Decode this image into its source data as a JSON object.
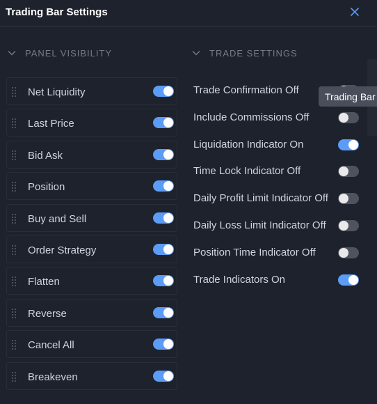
{
  "dialog": {
    "title": "Trading Bar Settings"
  },
  "panel_visibility": {
    "heading": "PANEL VISIBILITY",
    "items": [
      {
        "label": "Net Liquidity",
        "on": true
      },
      {
        "label": "Last Price",
        "on": true
      },
      {
        "label": "Bid Ask",
        "on": true
      },
      {
        "label": "Position",
        "on": true
      },
      {
        "label": "Buy and Sell",
        "on": true
      },
      {
        "label": "Order Strategy",
        "on": true
      },
      {
        "label": "Flatten",
        "on": true
      },
      {
        "label": "Reverse",
        "on": true
      },
      {
        "label": "Cancel All",
        "on": true
      },
      {
        "label": "Breakeven",
        "on": true
      }
    ]
  },
  "trade_settings": {
    "heading": "TRADE SETTINGS",
    "items": [
      {
        "label": "Trade Confirmation Off",
        "on": false
      },
      {
        "label": "Include Commissions Off",
        "on": false
      },
      {
        "label": "Liquidation Indicator On",
        "on": true
      },
      {
        "label": "Time Lock Indicator Off",
        "on": false
      },
      {
        "label": "Daily Profit Limit Indicator Off",
        "on": false
      },
      {
        "label": "Daily Loss Limit Indicator Off",
        "on": false
      },
      {
        "label": "Position Time Indicator Off",
        "on": false
      },
      {
        "label": "Trade Indicators On",
        "on": true
      }
    ]
  },
  "tooltip": {
    "text": "Trading Bar"
  },
  "colors": {
    "accent": "#5b9cf6",
    "background": "#1e222d",
    "toggle_off": "#50535e"
  }
}
